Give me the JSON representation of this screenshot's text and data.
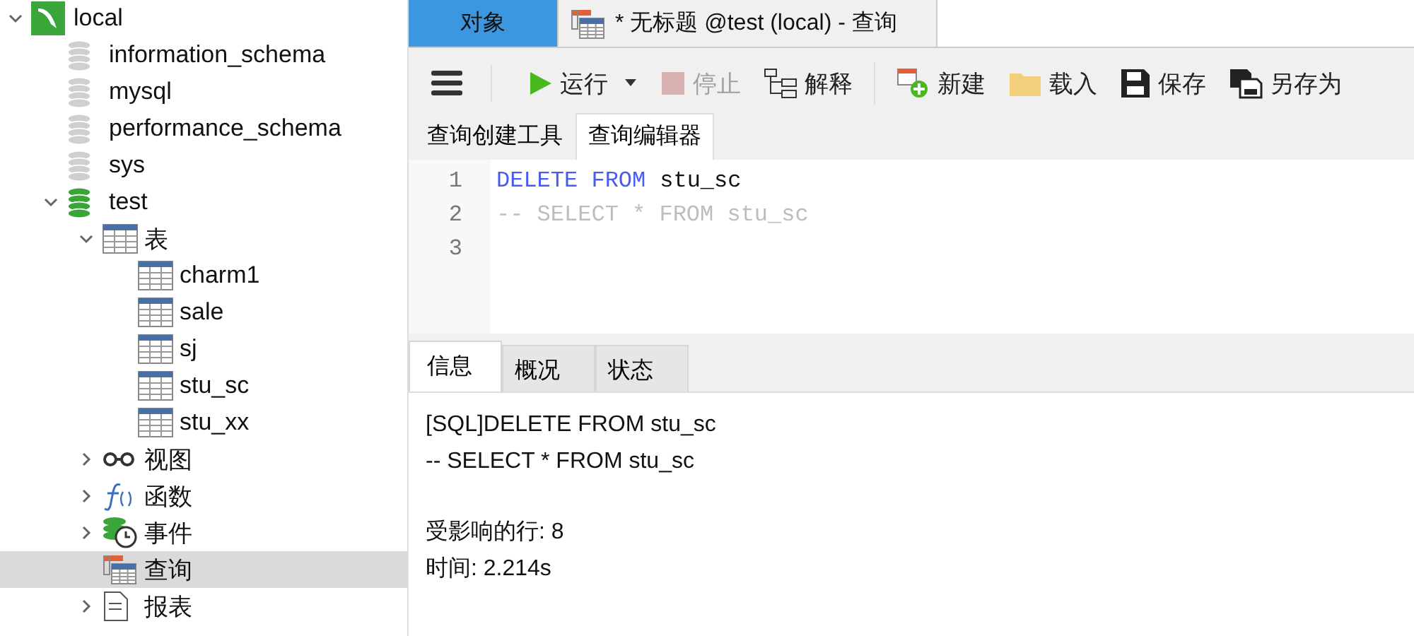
{
  "tree": [
    {
      "label": "local",
      "kind": "connection",
      "expanded": true,
      "selected": false,
      "children": [
        {
          "label": "information_schema",
          "kind": "database",
          "selected": false
        },
        {
          "label": "mysql",
          "kind": "database",
          "selected": false
        },
        {
          "label": "performance_schema",
          "kind": "database",
          "selected": false
        },
        {
          "label": "sys",
          "kind": "database",
          "selected": false
        },
        {
          "label": "test",
          "kind": "database-open",
          "expanded": true,
          "selected": false,
          "children": [
            {
              "label": "表",
              "kind": "tables",
              "expanded": true,
              "selected": false,
              "children": [
                {
                  "label": "charm1",
                  "kind": "table",
                  "selected": false
                },
                {
                  "label": "sale",
                  "kind": "table",
                  "selected": false
                },
                {
                  "label": "sj",
                  "kind": "table",
                  "selected": false
                },
                {
                  "label": "stu_sc",
                  "kind": "table",
                  "selected": false
                },
                {
                  "label": "stu_xx",
                  "kind": "table",
                  "selected": false
                }
              ]
            },
            {
              "label": "视图",
              "kind": "views",
              "expanded": false,
              "selected": false
            },
            {
              "label": "函数",
              "kind": "functions",
              "expanded": false,
              "selected": false
            },
            {
              "label": "事件",
              "kind": "events",
              "expanded": false,
              "selected": false
            },
            {
              "label": "查询",
              "kind": "queries",
              "selected": true
            },
            {
              "label": "报表",
              "kind": "reports",
              "expanded": false,
              "selected": false
            }
          ]
        }
      ]
    }
  ],
  "window_tabs": [
    {
      "label": "对象",
      "kind": "plain",
      "selected": true
    },
    {
      "label": "* 无标题 @test (local) - 查询",
      "kind": "query",
      "selected": false
    }
  ],
  "toolbar": [
    {
      "kind": "menu"
    },
    {
      "kind": "run",
      "label": "运行",
      "dropdown": true,
      "disabled": false
    },
    {
      "kind": "stop",
      "label": "停止",
      "disabled": true
    },
    {
      "kind": "explain",
      "label": "解释",
      "disabled": false
    },
    {
      "kind": "separator"
    },
    {
      "kind": "new",
      "label": "新建",
      "disabled": false
    },
    {
      "kind": "load",
      "label": "载入",
      "disabled": false
    },
    {
      "kind": "save",
      "label": "保存",
      "disabled": false
    },
    {
      "kind": "saveas",
      "label": "另存为",
      "disabled": false
    }
  ],
  "editor_tabs": [
    {
      "label": "查询创建工具",
      "selected": false
    },
    {
      "label": "查询编辑器",
      "selected": true
    }
  ],
  "editor_lines": [
    {
      "number": "1",
      "tokens": [
        {
          "kind": "keyword",
          "text": "DELETE FROM"
        },
        {
          "kind": "plain",
          "text": "stu_sc"
        }
      ]
    },
    {
      "number": "2",
      "tokens": [
        {
          "kind": "comment",
          "text": "-- SELECT * FROM stu_sc"
        }
      ]
    },
    {
      "number": "3"
    }
  ],
  "result_tabs": [
    {
      "label": "信息",
      "selected": true
    },
    {
      "label": "概况",
      "selected": false
    },
    {
      "label": "状态",
      "selected": false
    }
  ],
  "message_groups": [
    [
      "[SQL]DELETE FROM stu_sc",
      "-- SELECT * FROM stu_sc"
    ],
    [
      "受影响的行: 8",
      "时间: 2.214s"
    ]
  ]
}
